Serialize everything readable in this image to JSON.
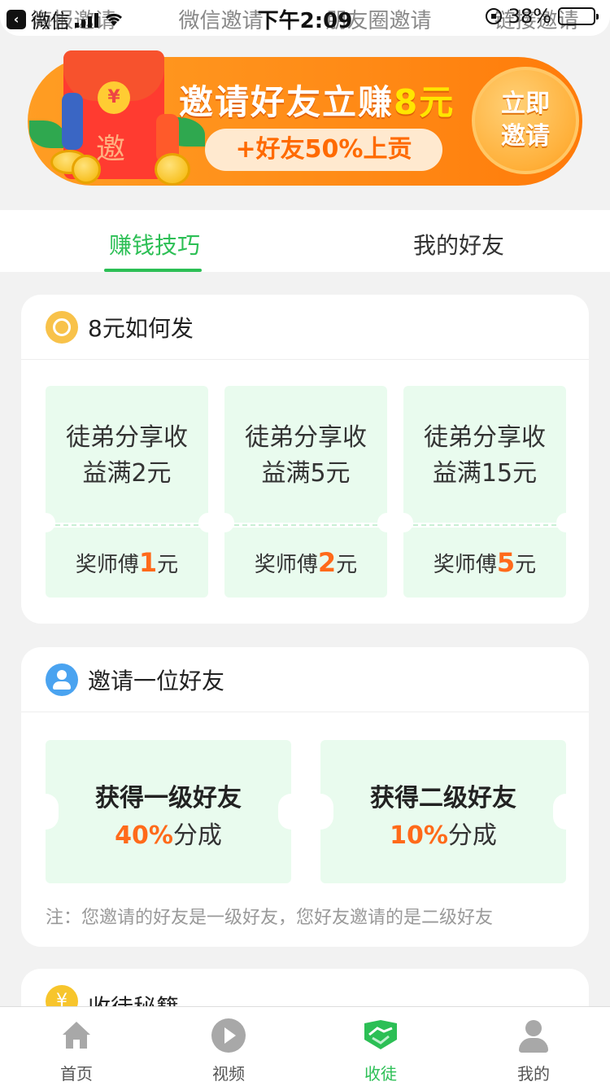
{
  "status_bar": {
    "carrier": "微信",
    "time": "下午2:09",
    "battery": "38%",
    "battery_level": 0.38
  },
  "share_tabs": [
    "海报邀请",
    "微信邀请",
    "朋友圈邀请",
    "链接邀请"
  ],
  "banner": {
    "title_main": "邀请好友立赚",
    "title_amount": "8元",
    "subtitle": "+好友50%上贡",
    "button_line1": "立即",
    "button_line2": "邀请",
    "envelope_char": "邀",
    "coin_symbol": "¥"
  },
  "tabs": [
    {
      "label": "赚钱技巧",
      "active": true
    },
    {
      "label": "我的好友",
      "active": false
    }
  ],
  "card_payout": {
    "title": "8元如何发",
    "items": [
      {
        "line1": "徒弟分享收",
        "line2": "益满2元",
        "reward_prefix": "奖师傅",
        "reward_amount": "1",
        "reward_unit": "元"
      },
      {
        "line1": "徒弟分享收",
        "line2": "益满5元",
        "reward_prefix": "奖师傅",
        "reward_amount": "2",
        "reward_unit": "元"
      },
      {
        "line1": "徒弟分享收",
        "line2": "益满15元",
        "reward_prefix": "奖师傅",
        "reward_amount": "5",
        "reward_unit": "元"
      }
    ]
  },
  "card_invite": {
    "title": "邀请一位好友",
    "items": [
      {
        "title": "获得一级好友",
        "percent": "40%",
        "suffix": "分成"
      },
      {
        "title": "获得二级好友",
        "percent": "10%",
        "suffix": "分成"
      }
    ],
    "note": "注：您邀请的好友是一级好友，您好友邀请的是二级好友"
  },
  "card_secrets": {
    "title": "收徒秘籍",
    "icon_symbol": "¥"
  },
  "bottom_nav": [
    {
      "label": "首页",
      "icon": "home-icon",
      "active": false
    },
    {
      "label": "视频",
      "icon": "play-icon",
      "active": false
    },
    {
      "label": "收徒",
      "icon": "handshake-icon",
      "active": true
    },
    {
      "label": "我的",
      "icon": "user-icon",
      "active": false
    }
  ],
  "colors": {
    "accent_green": "#2cbf55",
    "accent_orange": "#ff6a1a",
    "ticket_bg": "#e9fbee",
    "banner_orange": "#ff8a16"
  }
}
